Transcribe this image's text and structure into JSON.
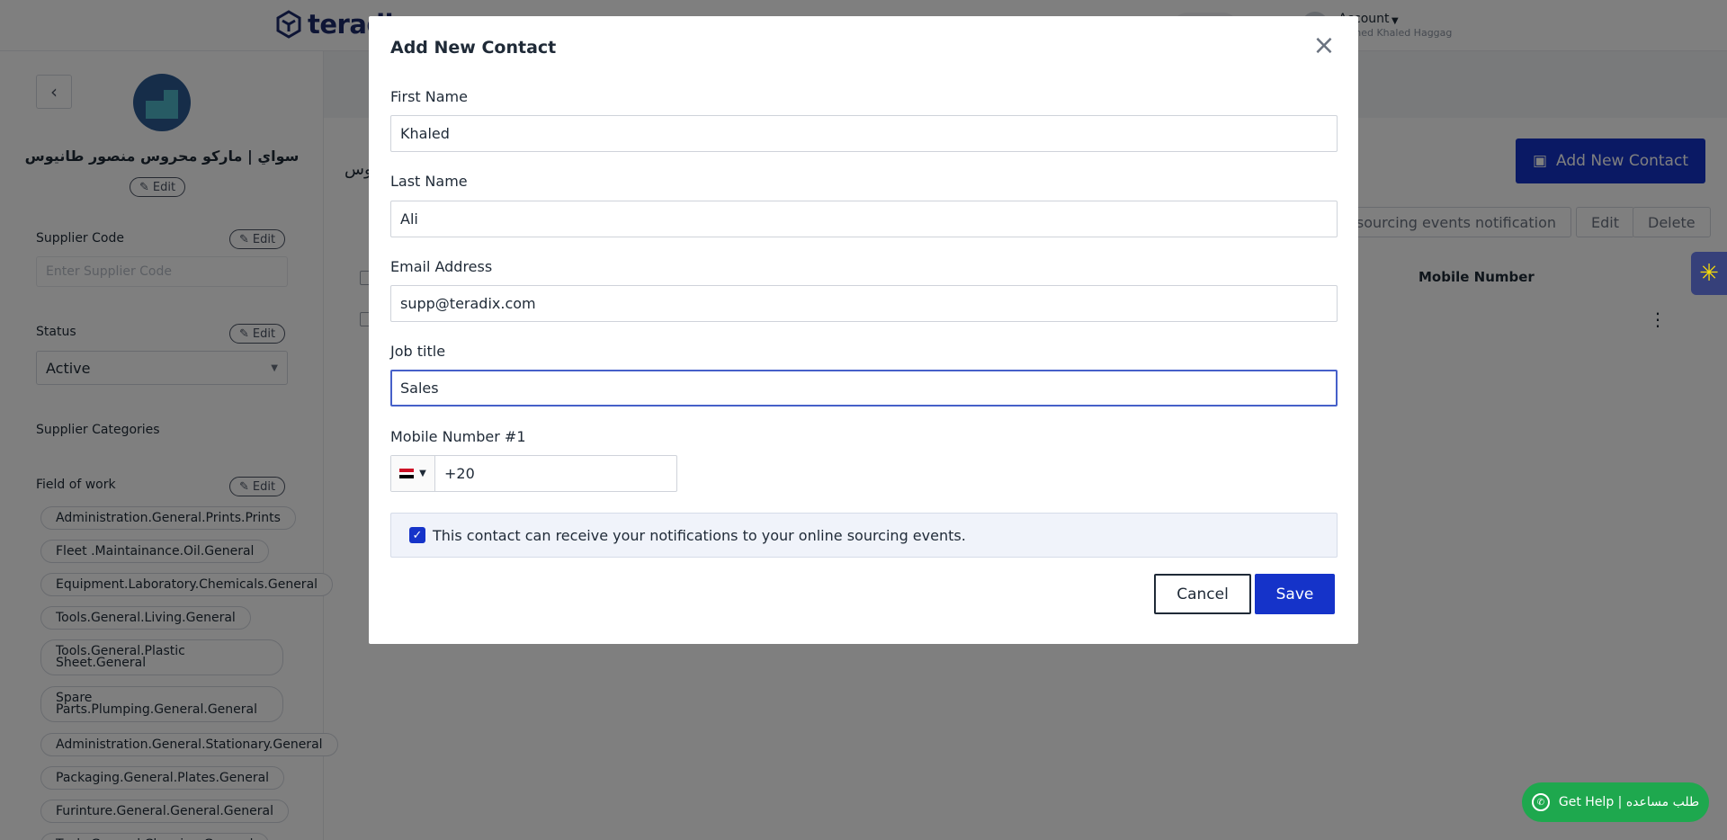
{
  "header": {
    "logo_text": "teradix",
    "account_label": "Account",
    "account_sub": "Ahmed Khaled Haggag"
  },
  "sidebar": {
    "supplier_name": "سواي | ماركو محروس منصور طانيوس",
    "edit_label": "Edit",
    "supplier_code_label": "Supplier Code",
    "supplier_code_placeholder": "Enter Supplier Code",
    "status_label": "Status",
    "status_value": "Active",
    "categories_label": "Supplier Categories",
    "field_of_work_label": "Field of work",
    "fields_of_work": [
      "Administration.General.Prints.Prints",
      "Fleet .Maintainance.Oil.General",
      "Equipment.Laboratory.Chemicals.General",
      "Tools.General.Living.General",
      "Tools.General.Plastic Sheet.General",
      "Spare Parts.Plumping.General.General",
      "Administration.General.Stationary.General",
      "Packaging.General.Plates.General",
      "Furinture.General.General.General",
      "Tools.General.Cleaning.General"
    ]
  },
  "main": {
    "title_fragment": "وس",
    "add_contact_label": "Add New Contact",
    "notification_btn": "ed sourcing events notification",
    "edit_btn": "Edit",
    "delete_btn": "Delete",
    "col_mobile": "Mobile Number"
  },
  "help": {
    "label": "Get Help | طلب مساعده"
  },
  "modal": {
    "title": "Add New Contact",
    "first_name_label": "First Name",
    "first_name_value": "Khaled",
    "last_name_label": "Last Name",
    "last_name_value": "Ali",
    "email_label": "Email Address",
    "email_value": "supp@teradix.com",
    "job_title_label": "Job title",
    "job_title_value": "Sales",
    "mobile_label": "Mobile Number #1",
    "mobile_value": "+20",
    "notify_text": "This contact can receive your notifications to your online sourcing events.",
    "cancel_label": "Cancel",
    "save_label": "Save"
  },
  "colors": {
    "primary": "#1533c9",
    "help_green": "#1ea84e",
    "focus_border": "#4660c9"
  }
}
